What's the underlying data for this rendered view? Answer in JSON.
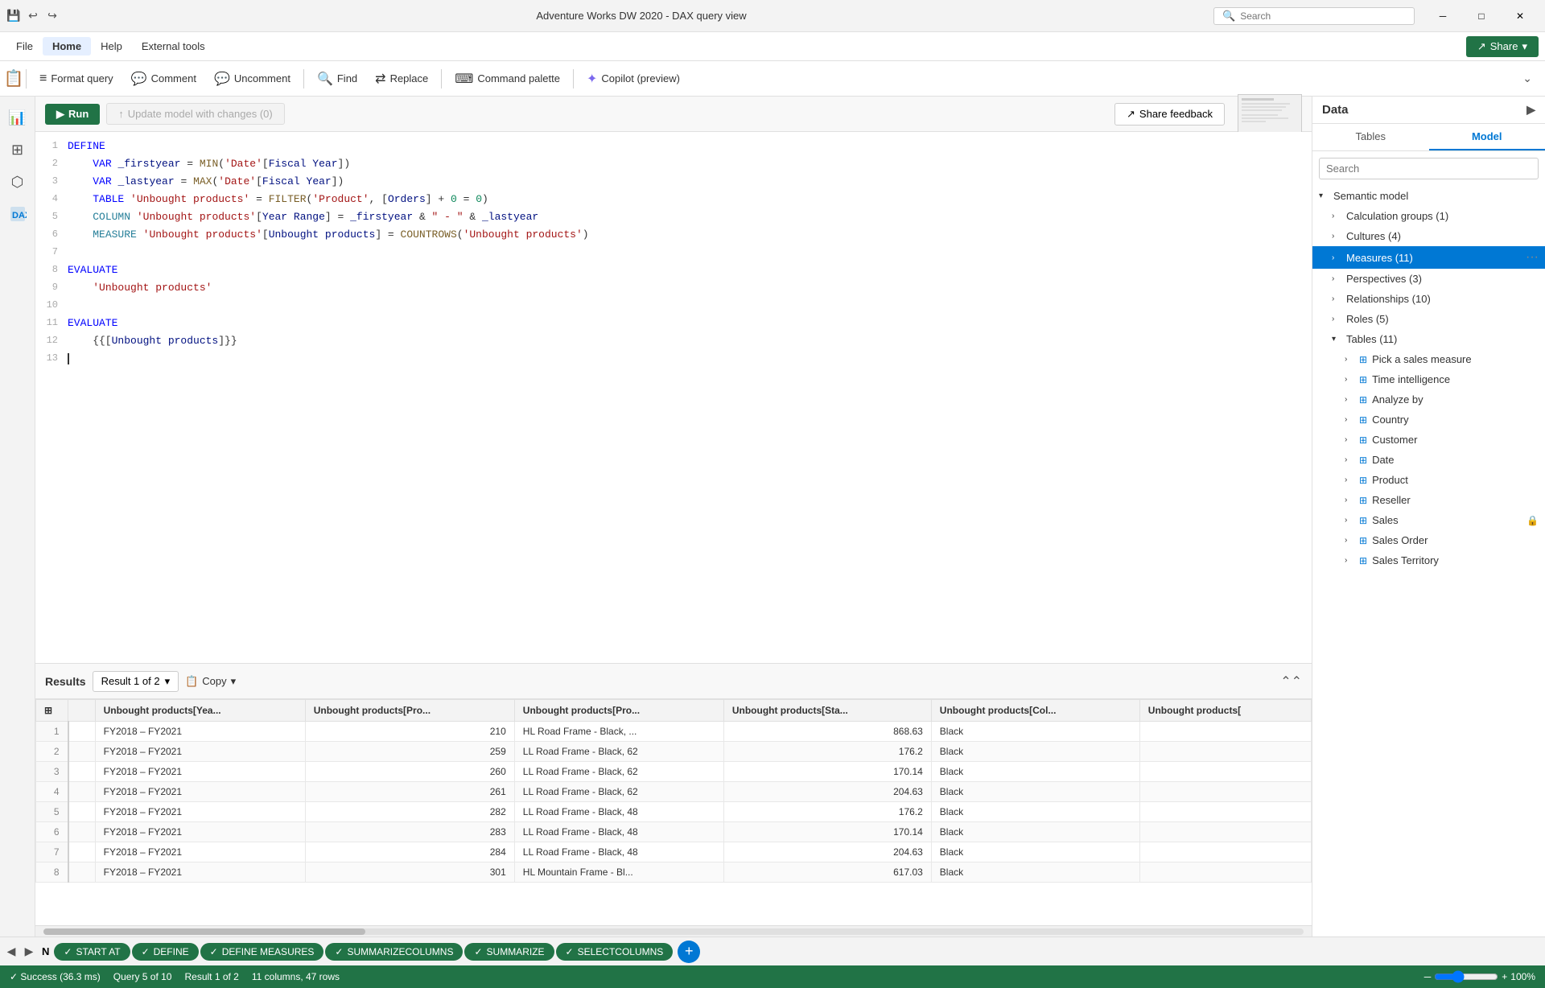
{
  "titlebar": {
    "title": "Adventure Works DW 2020 - DAX query view",
    "search_placeholder": "Search"
  },
  "menubar": {
    "items": [
      "File",
      "Home",
      "Help",
      "External tools"
    ],
    "active": "Home",
    "share_label": "Share"
  },
  "toolbar": {
    "buttons": [
      {
        "id": "format-query",
        "icon": "≡",
        "label": "Format query"
      },
      {
        "id": "comment",
        "icon": "💬",
        "label": "Comment"
      },
      {
        "id": "uncomment",
        "icon": "💬",
        "label": "Uncomment"
      },
      {
        "id": "find",
        "icon": "🔍",
        "label": "Find"
      },
      {
        "id": "replace",
        "icon": "↔",
        "label": "Replace"
      },
      {
        "id": "command-palette",
        "icon": "⌨",
        "label": "Command palette"
      },
      {
        "id": "copilot",
        "icon": "✨",
        "label": "Copilot (preview)"
      }
    ]
  },
  "run_toolbar": {
    "run_label": "Run",
    "update_label": "Update model with changes (0)",
    "share_feedback_label": "Share feedback"
  },
  "code": {
    "lines": [
      {
        "num": 1,
        "content": "DEFINE",
        "type": "define"
      },
      {
        "num": 2,
        "content": "    VAR _firstyear = MIN('Date'[Fiscal Year])",
        "type": "var"
      },
      {
        "num": 3,
        "content": "    VAR _lastyear = MAX('Date'[Fiscal Year])",
        "type": "var"
      },
      {
        "num": 4,
        "content": "    TABLE 'Unbought products' = FILTER('Product', [Orders] + 0 = 0)",
        "type": "table"
      },
      {
        "num": 5,
        "content": "    COLUMN 'Unbought products'[Year Range] = _firstyear & \" - \" & _lastyear",
        "type": "column"
      },
      {
        "num": 6,
        "content": "    MEASURE 'Unbought products'[Unbought products] = COUNTROWS('Unbought products')",
        "type": "measure"
      },
      {
        "num": 7,
        "content": "",
        "type": "empty"
      },
      {
        "num": 8,
        "content": "EVALUATE",
        "type": "evaluate"
      },
      {
        "num": 9,
        "content": "    'Unbought products'",
        "type": "code"
      },
      {
        "num": 10,
        "content": "",
        "type": "empty"
      },
      {
        "num": 11,
        "content": "EVALUATE",
        "type": "evaluate"
      },
      {
        "num": 12,
        "content": "    {{[Unbought products]}}",
        "type": "code"
      },
      {
        "num": 13,
        "content": "",
        "type": "cursor"
      }
    ]
  },
  "results": {
    "title": "Results",
    "result_of": "Result 1 of 2",
    "copy_label": "Copy",
    "columns": [
      "",
      "",
      "Unbought products[Yea...",
      "Unbought products[Pro...",
      "Unbought products[Pro...",
      "Unbought products[Sta...",
      "Unbought products[Col...",
      "Unbought products["
    ],
    "rows": [
      {
        "num": 1,
        "col1": "FY2018 – FY2021",
        "col2": "",
        "col3": "210",
        "col4": "HL Road Frame - Black, ...",
        "col5": "868.63",
        "col6": "Black"
      },
      {
        "num": 2,
        "col1": "FY2018 – FY2021",
        "col2": "",
        "col3": "259",
        "col4": "LL Road Frame - Black, 62",
        "col5": "176.2",
        "col6": "Black"
      },
      {
        "num": 3,
        "col1": "FY2018 – FY2021",
        "col2": "",
        "col3": "260",
        "col4": "LL Road Frame - Black, 62",
        "col5": "170.14",
        "col6": "Black"
      },
      {
        "num": 4,
        "col1": "FY2018 – FY2021",
        "col2": "",
        "col3": "261",
        "col4": "LL Road Frame - Black, 62",
        "col5": "204.63",
        "col6": "Black"
      },
      {
        "num": 5,
        "col1": "FY2018 – FY2021",
        "col2": "",
        "col3": "282",
        "col4": "LL Road Frame - Black, 48",
        "col5": "176.2",
        "col6": "Black"
      },
      {
        "num": 6,
        "col1": "FY2018 – FY2021",
        "col2": "",
        "col3": "283",
        "col4": "LL Road Frame - Black, 48",
        "col5": "170.14",
        "col6": "Black"
      },
      {
        "num": 7,
        "col1": "FY2018 – FY2021",
        "col2": "",
        "col3": "284",
        "col4": "LL Road Frame - Black, 48",
        "col5": "204.63",
        "col6": "Black"
      },
      {
        "num": 8,
        "col1": "FY2018 – FY2021",
        "col2": "",
        "col3": "301",
        "col4": "HL Mountain Frame - Bl...",
        "col5": "617.03",
        "col6": "Black"
      }
    ]
  },
  "status_tabs": [
    {
      "label": "N",
      "type": "nav"
    },
    {
      "label": "START AT",
      "type": "green",
      "icon": "✓"
    },
    {
      "label": "DEFINE",
      "type": "green",
      "icon": "✓"
    },
    {
      "label": "DEFINE MEASURES",
      "type": "green",
      "icon": "✓"
    },
    {
      "label": "SUMMARIZECOLUMNS",
      "type": "green",
      "icon": "✓"
    },
    {
      "label": "SUMMARIZE",
      "type": "green",
      "icon": "✓"
    },
    {
      "label": "SELECTCOLUMNS",
      "type": "green",
      "icon": "✓"
    }
  ],
  "statusbar": {
    "success": "✓ Success (36.3 ms)",
    "query": "Query 5 of 10",
    "result": "Result 1 of 2",
    "columns_rows": "11 columns, 47 rows",
    "zoom": "100%"
  },
  "data_panel": {
    "title": "Data",
    "tabs": [
      "Tables",
      "Model"
    ],
    "active_tab": "Model",
    "search_placeholder": "Search",
    "tree": [
      {
        "label": "Semantic model",
        "level": 0,
        "expanded": true,
        "type": "folder"
      },
      {
        "label": "Calculation groups (1)",
        "level": 1,
        "expanded": false,
        "type": "folder"
      },
      {
        "label": "Cultures (4)",
        "level": 1,
        "expanded": false,
        "type": "folder"
      },
      {
        "label": "Measures (11)",
        "level": 1,
        "expanded": false,
        "type": "folder",
        "active": true
      },
      {
        "label": "Perspectives (3)",
        "level": 1,
        "expanded": false,
        "type": "folder"
      },
      {
        "label": "Relationships (10)",
        "level": 1,
        "expanded": false,
        "type": "folder"
      },
      {
        "label": "Roles (5)",
        "level": 1,
        "expanded": false,
        "type": "folder"
      },
      {
        "label": "Tables (11)",
        "level": 1,
        "expanded": true,
        "type": "folder"
      },
      {
        "label": "Pick a sales measure",
        "level": 2,
        "type": "table"
      },
      {
        "label": "Time intelligence",
        "level": 2,
        "type": "table"
      },
      {
        "label": "Analyze by",
        "level": 2,
        "type": "table"
      },
      {
        "label": "Country",
        "level": 2,
        "type": "table"
      },
      {
        "label": "Customer",
        "level": 2,
        "type": "table"
      },
      {
        "label": "Date",
        "level": 2,
        "type": "table"
      },
      {
        "label": "Product",
        "level": 2,
        "type": "table"
      },
      {
        "label": "Reseller",
        "level": 2,
        "type": "table"
      },
      {
        "label": "Sales",
        "level": 2,
        "type": "table"
      },
      {
        "label": "Sales Order",
        "level": 2,
        "type": "table"
      },
      {
        "label": "Sales Territory",
        "level": 2,
        "type": "table"
      }
    ]
  }
}
